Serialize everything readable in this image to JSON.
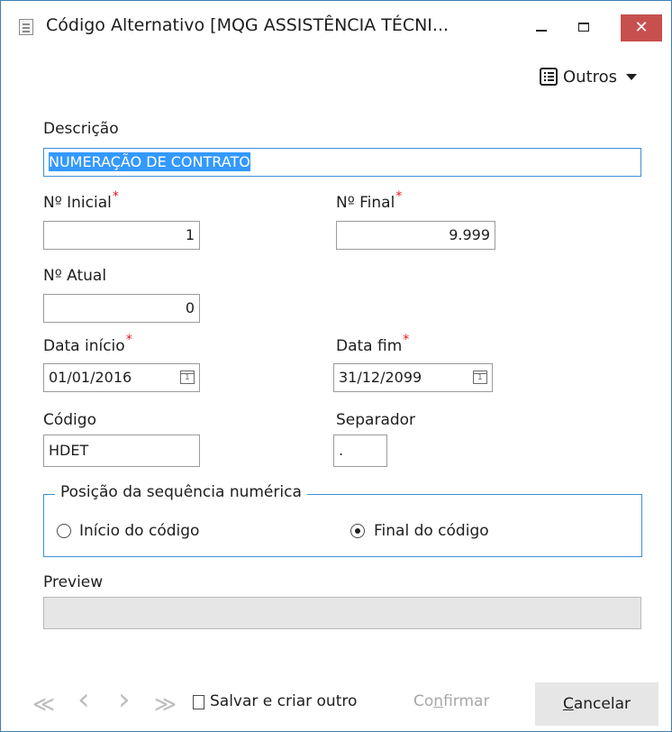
{
  "window": {
    "title": "Código Alternativo [MQG ASSISTÊNCIA TÉCNI...",
    "close_glyph": "✕"
  },
  "toolbar": {
    "outros_label": "Outros"
  },
  "form": {
    "descricao": {
      "label": "Descrição",
      "value": "NUMERAÇÃO DE CONTRATO"
    },
    "n_inicial": {
      "label": "Nº Inicial",
      "required_mark": "*",
      "value": "1"
    },
    "n_final": {
      "label": "Nº Final",
      "required_mark": "*",
      "value": "9.999"
    },
    "n_atual": {
      "label": "Nº Atual",
      "value": "0"
    },
    "data_inicio": {
      "label": "Data início",
      "required_mark": "*",
      "value": "01/01/2016"
    },
    "data_fim": {
      "label": "Data fim",
      "required_mark": "*",
      "value": "31/12/2099"
    },
    "codigo": {
      "label": "Código",
      "value": "HDET"
    },
    "separador": {
      "label": "Separador",
      "value": "."
    },
    "posicao": {
      "title": "Posição da sequência numérica",
      "options": [
        {
          "label": "Início do código",
          "selected": false
        },
        {
          "label": "Final do código",
          "selected": true
        }
      ]
    },
    "preview": {
      "label": "Preview",
      "value": ""
    }
  },
  "footer": {
    "first_glyph": "≪",
    "prev_glyph": "‹",
    "next_glyph": "›",
    "last_glyph": "≫",
    "save_and_new_label": "Salvar e criar outro",
    "save_and_new_checked": false,
    "confirm_label_pre": "Co",
    "confirm_label_accel": "n",
    "confirm_label_post": "firmar",
    "cancel_label_accel": "C",
    "cancel_label_post": "ancelar"
  },
  "colors": {
    "accent": "#3c8fd6",
    "close_button": "#c7504f",
    "required": "#e0161e",
    "selection": "#3399ff",
    "disabled_text": "#a8a8a8"
  },
  "icons": [
    "app-icon",
    "list-icon",
    "chevron-down-icon",
    "calendar-icon",
    "minimize-icon",
    "maximize-icon",
    "close-icon"
  ]
}
